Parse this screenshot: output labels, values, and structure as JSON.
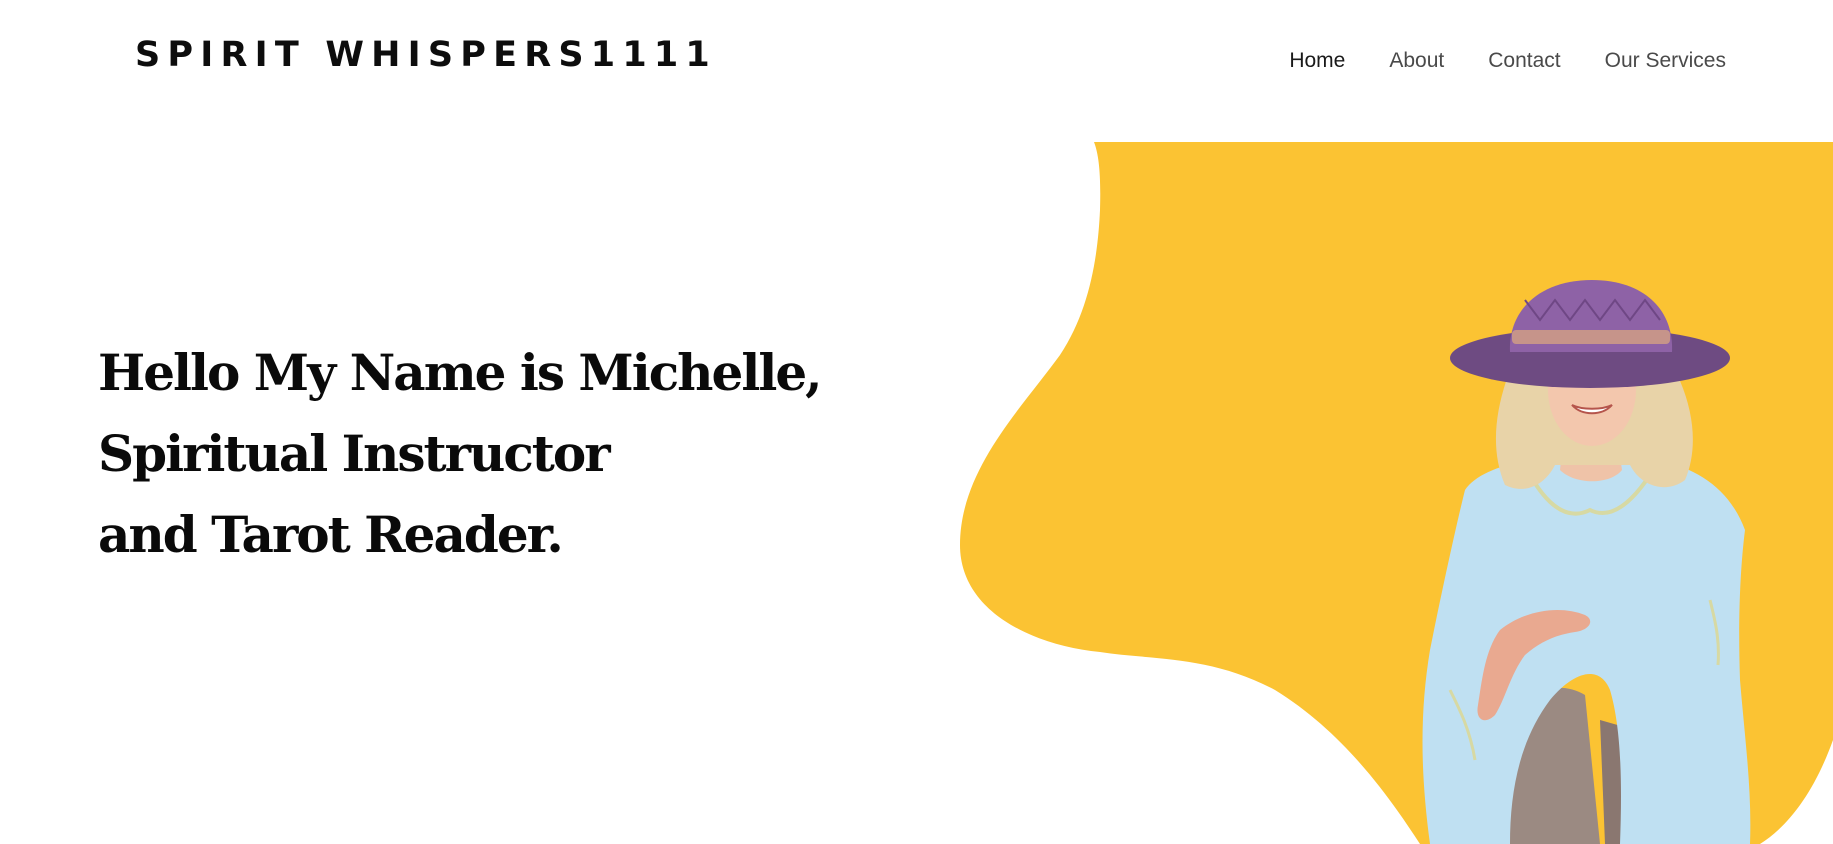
{
  "header": {
    "logo_text": "SPIRIT WHISPERS1111",
    "nav": [
      {
        "label": "Home",
        "active": true
      },
      {
        "label": "About",
        "active": false
      },
      {
        "label": "Contact",
        "active": false
      },
      {
        "label": "Our Services",
        "active": false
      }
    ]
  },
  "hero": {
    "heading_lines": [
      "Hello My Name is Michelle,",
      "Spiritual Instructor",
      "and Tarot Reader."
    ]
  },
  "colors": {
    "accent_blob": "#fbc333",
    "text": "#0a0a0a",
    "nav_text": "#4a4a4a"
  },
  "icons": {
    "hero_photo": "woman-in-purple-hat-photo"
  }
}
